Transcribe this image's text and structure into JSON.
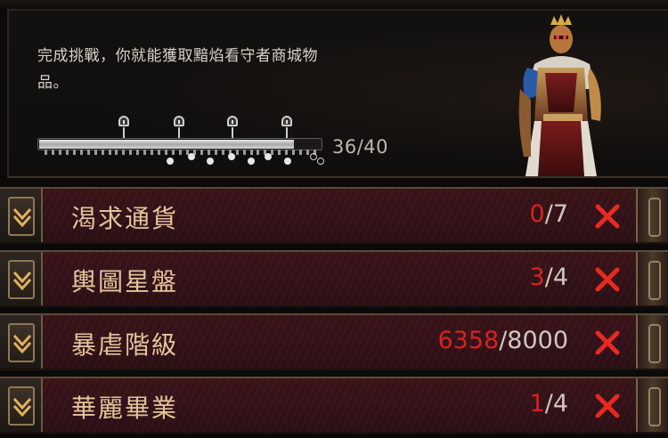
{
  "description": "完成挑戰，你就能獲取黯焰看守者商城物品。",
  "progress": {
    "current": 36,
    "total": 40,
    "label": "36/40"
  },
  "milestones_unlocked": 4,
  "colors": {
    "accent_red": "#d8221e",
    "title_gold": "#e6c49a",
    "row_bg": "#3b1416"
  },
  "challenges": [
    {
      "title": "渴求通貨",
      "current": "0",
      "total": "/7",
      "complete": false,
      "status_icon": "red-x-icon"
    },
    {
      "title": "輿圖星盤",
      "current": "3",
      "total": "/4",
      "complete": false,
      "status_icon": "red-x-icon"
    },
    {
      "title": "暴虐階級",
      "current": "6358",
      "total": "/8000",
      "complete": false,
      "status_icon": "red-x-icon"
    },
    {
      "title": "華麗畢業",
      "current": "1",
      "total": "/4",
      "complete": false,
      "status_icon": "red-x-icon"
    }
  ],
  "icons": {
    "row_icon": "expand-chevron-icon",
    "milestone": "lock-icon",
    "portrait": "crowned-warden-figure"
  }
}
